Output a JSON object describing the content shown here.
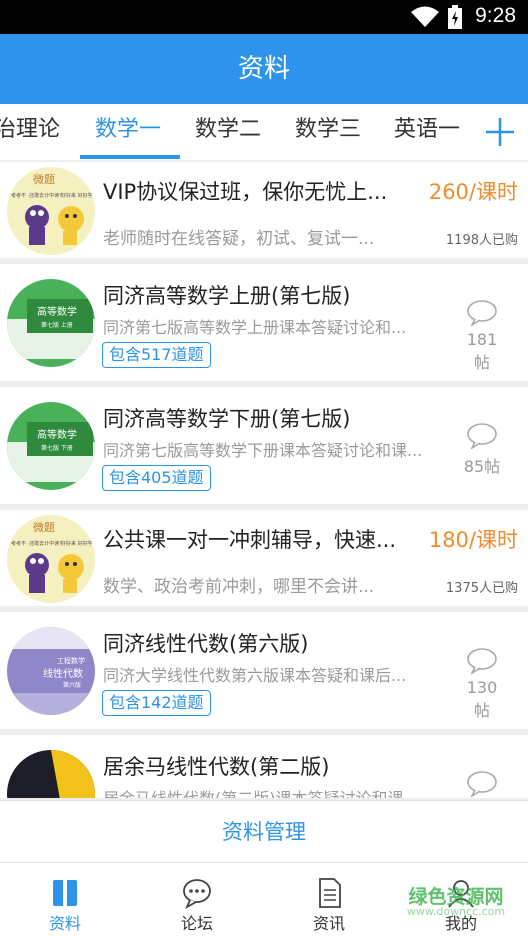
{
  "status_bar": {
    "time": "9:28"
  },
  "header": {
    "title": "资料"
  },
  "tabs": [
    "治理论",
    "数学一",
    "数学二",
    "数学三",
    "英语一"
  ],
  "active_tab": 1,
  "items": [
    {
      "type": "course",
      "title": "VIP协议保过班，保你无忧上...",
      "desc": "老师随时在线答疑，初试、复试一...",
      "price": "260/课时",
      "buyers": "1198人已购"
    },
    {
      "type": "book",
      "title": "同济高等数学上册(第七版)",
      "desc": "同济第七版高等数学上册课本答疑讨论和...",
      "badge": "包含517道题",
      "posts": "181帖"
    },
    {
      "type": "book",
      "title": "同济高等数学下册(第七版)",
      "desc": "同济第七版高等数学下册课本答疑讨论和课...",
      "badge": "包含405道题",
      "posts": "85帖"
    },
    {
      "type": "course",
      "title": "公共课一对一冲刺辅导，快速...",
      "desc": "数学、政治考前冲刺，哪里不会讲...",
      "price": "180/课时",
      "buyers": "1375人已购"
    },
    {
      "type": "book",
      "title": "同济线性代数(第六版)",
      "desc": "同济大学线性代数第六版课本答疑和课后...",
      "badge": "包含142道题",
      "posts": "130帖"
    },
    {
      "type": "book",
      "title": "居余马线性代数(第二版)",
      "desc": "居余马线性代数(第二版)课本答疑讨论和课...",
      "badge": "",
      "posts": ""
    }
  ],
  "thumbs": {
    "course": {
      "top_text": "微题",
      "side_text": "考考不 ·还敢去计中读?",
      "right_text": "好好来 好好学"
    },
    "math_book": {
      "line1": "高等数学",
      "line2": "第七版 上册"
    },
    "math_book2": {
      "line1": "高等数学",
      "line2": "第七版 下册"
    },
    "linear": {
      "line1": "工程数学",
      "line2": "线性代数",
      "line3": "第六版"
    }
  },
  "manage": {
    "label": "资料管理"
  },
  "nav": [
    {
      "label": "资料",
      "icon": "book-icon",
      "active": true
    },
    {
      "label": "论坛",
      "icon": "chat-icon",
      "active": false
    },
    {
      "label": "资讯",
      "icon": "document-icon",
      "active": false
    },
    {
      "label": "我的",
      "icon": "person-icon",
      "active": false
    }
  ],
  "watermark": {
    "line1": "绿色资源网",
    "line2": "www.downcc.com"
  },
  "colors": {
    "primary": "#2e93ea",
    "price": "#f08c2c",
    "muted": "#9a9a9a"
  }
}
